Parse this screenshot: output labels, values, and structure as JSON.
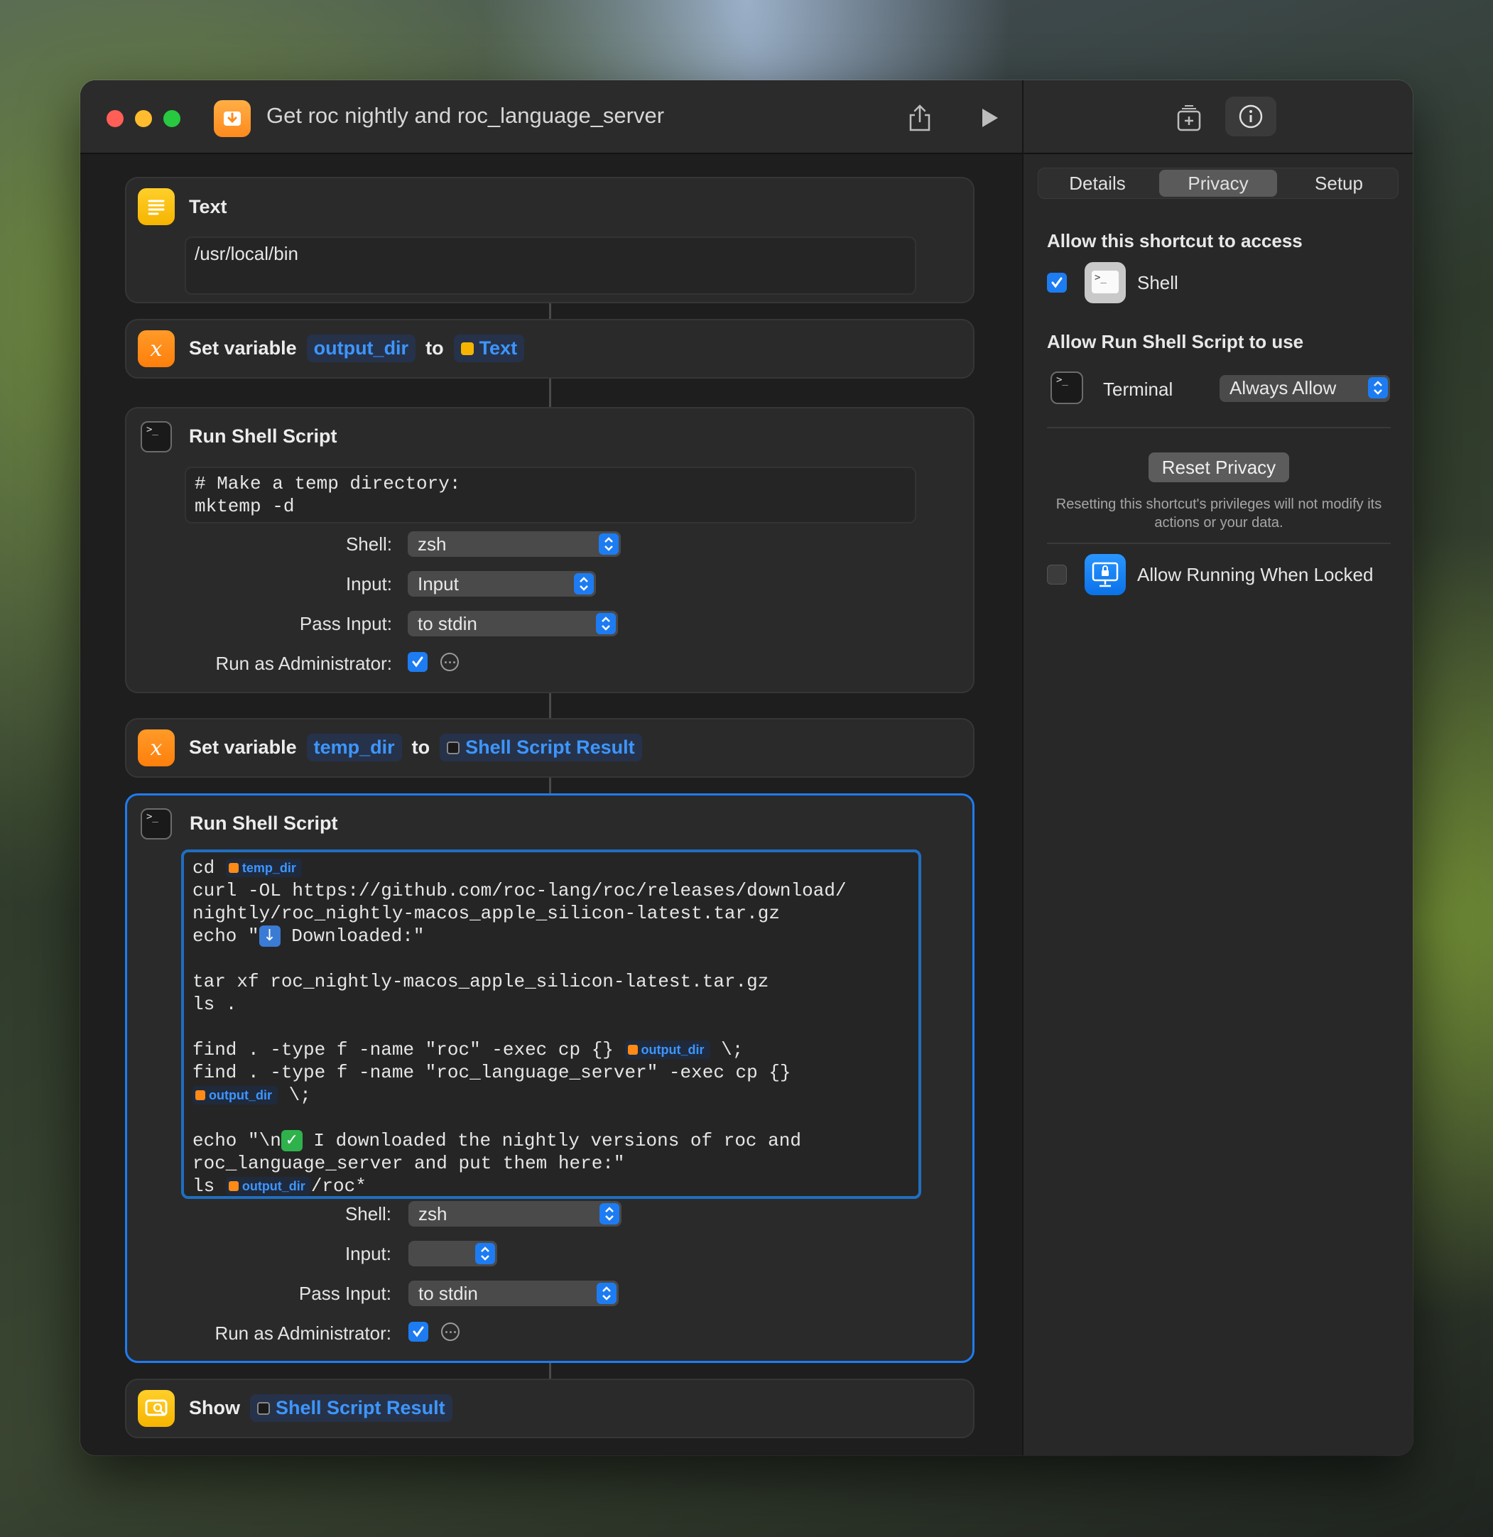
{
  "window": {
    "title": "Get roc nightly and roc_language_server"
  },
  "actions": {
    "text": {
      "title": "Text",
      "value": "/usr/local/bin"
    },
    "set1": {
      "label": "Set variable",
      "var": "output_dir",
      "to": "to",
      "value": "Text"
    },
    "shell1": {
      "title": "Run Shell Script",
      "script": "# Make a temp directory:\nmktemp -d",
      "shell_label": "Shell:",
      "shell": "zsh",
      "input_label": "Input:",
      "input": "Input",
      "pass_label": "Pass Input:",
      "pass": "to stdin",
      "admin_label": "Run as Administrator:"
    },
    "set2": {
      "label": "Set variable",
      "var": "temp_dir",
      "to": "to",
      "value": "Shell Script Result"
    },
    "shell2": {
      "title": "Run Shell Script",
      "cd": "cd",
      "temp_dir_token": "temp_dir",
      "curl1": "curl -OL https://github.com/roc-lang/roc/releases/download/",
      "curl2": "nightly/roc_nightly-macos_apple_silicon-latest.tar.gz",
      "echo1a": "echo \"",
      "echo1b": " Downloaded:\"",
      "tar": "tar xf roc_nightly-macos_apple_silicon-latest.tar.gz",
      "ls1": "ls .",
      "find1a": "find . -type f -name \"roc\" -exec cp {}",
      "find1b": "\\;",
      "find2": "find . -type f -name \"roc_language_server\" -exec cp {}",
      "find2b": "\\;",
      "echo2a": "echo \"\\n",
      "echo2b": " I downloaded the nightly versions of roc and",
      "echo2c": "roc_language_server and put them here:\"",
      "ls2a": "ls",
      "ls2b": "/roc*",
      "output_dir_token": "output_dir",
      "shell_label": "Shell:",
      "shell": "zsh",
      "input_label": "Input:",
      "input": "",
      "pass_label": "Pass Input:",
      "pass": "to stdin",
      "admin_label": "Run as Administrator:"
    },
    "show": {
      "label": "Show",
      "value": "Shell Script Result"
    }
  },
  "inspector": {
    "tabs": [
      "Details",
      "Privacy",
      "Setup"
    ],
    "active_tab": "Privacy",
    "access_heading": "Allow this shortcut to access",
    "shell_item": "Shell",
    "use_heading": "Allow Run Shell Script to use",
    "terminal_item": "Terminal",
    "terminal_permission": "Always Allow",
    "reset_button": "Reset Privacy",
    "reset_note": "Resetting this shortcut's privileges will not modify its actions or your data.",
    "locked_label": "Allow Running When Locked"
  },
  "colors": {
    "accent": "#1d7cf2",
    "token_text": "#3d96ff",
    "window_bg": "#1e1e1e"
  }
}
